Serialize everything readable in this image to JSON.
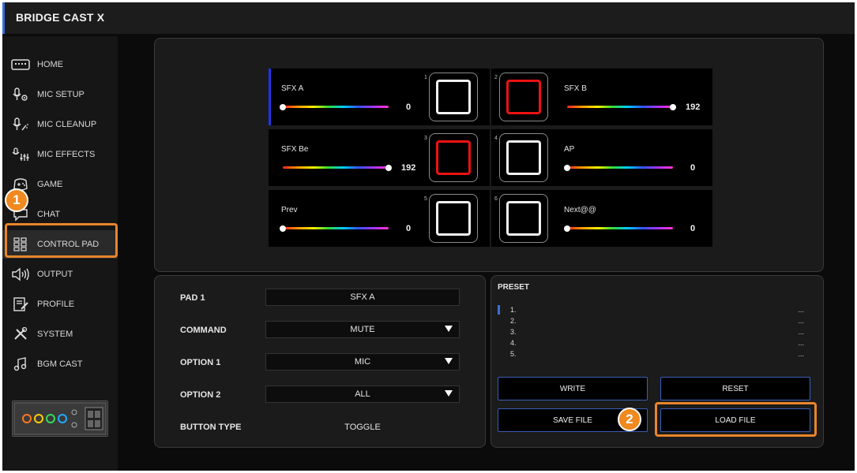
{
  "app": {
    "title": "BRIDGE CAST X"
  },
  "sidebar": {
    "items": [
      {
        "label": "HOME",
        "icon": "keyboard-icon"
      },
      {
        "label": "MIC SETUP",
        "icon": "mic-gear-icon"
      },
      {
        "label": "MIC CLEANUP",
        "icon": "mic-sparkle-icon"
      },
      {
        "label": "MIC EFFECTS",
        "icon": "mic-sliders-icon"
      },
      {
        "label": "GAME",
        "icon": "gamepad-icon"
      },
      {
        "label": "CHAT",
        "icon": "chat-icon"
      },
      {
        "label": "CONTROL PAD",
        "icon": "grid-pad-icon",
        "active": true
      },
      {
        "label": "OUTPUT",
        "icon": "speaker-icon"
      },
      {
        "label": "PROFILE",
        "icon": "profile-edit-icon"
      },
      {
        "label": "SYSTEM",
        "icon": "tools-icon"
      },
      {
        "label": "BGM CAST",
        "icon": "music-note-icon"
      }
    ]
  },
  "callouts": {
    "one": "1",
    "two": "2"
  },
  "pads": [
    {
      "num": "1",
      "name": "SFX A",
      "value": "0",
      "level": 0,
      "color": "white"
    },
    {
      "num": "2",
      "name": "SFX B",
      "value": "192",
      "level": 1,
      "color": "red"
    },
    {
      "num": "3",
      "name": "SFX Be",
      "value": "192",
      "level": 1,
      "color": "red"
    },
    {
      "num": "4",
      "name": "AP",
      "value": "0",
      "level": 0,
      "color": "white"
    },
    {
      "num": "5",
      "name": "Prev",
      "value": "0",
      "level": 0,
      "color": "white"
    },
    {
      "num": "6",
      "name": "Next@@",
      "value": "0",
      "level": 0,
      "color": "white"
    }
  ],
  "properties": {
    "pad_label": "PAD 1",
    "pad_value": "SFX A",
    "command_label": "COMMAND",
    "command_value": "MUTE",
    "option1_label": "OPTION 1",
    "option1_value": "MIC",
    "option2_label": "OPTION 2",
    "option2_value": "ALL",
    "button_type_label": "BUTTON TYPE",
    "button_type_value": "TOGGLE"
  },
  "preset": {
    "title": "PRESET",
    "items": [
      {
        "num": "1.",
        "value": "..."
      },
      {
        "num": "2.",
        "value": "..."
      },
      {
        "num": "3.",
        "value": "..."
      },
      {
        "num": "4.",
        "value": "..."
      },
      {
        "num": "5.",
        "value": "..."
      }
    ],
    "buttons": {
      "write": "WRITE",
      "reset": "RESET",
      "save": "SAVE FILE",
      "load": "LOAD FILE"
    }
  },
  "colors": {
    "accent": "#3b6fd8",
    "callout": "#f0891f",
    "pad_red": "#ee1111"
  }
}
